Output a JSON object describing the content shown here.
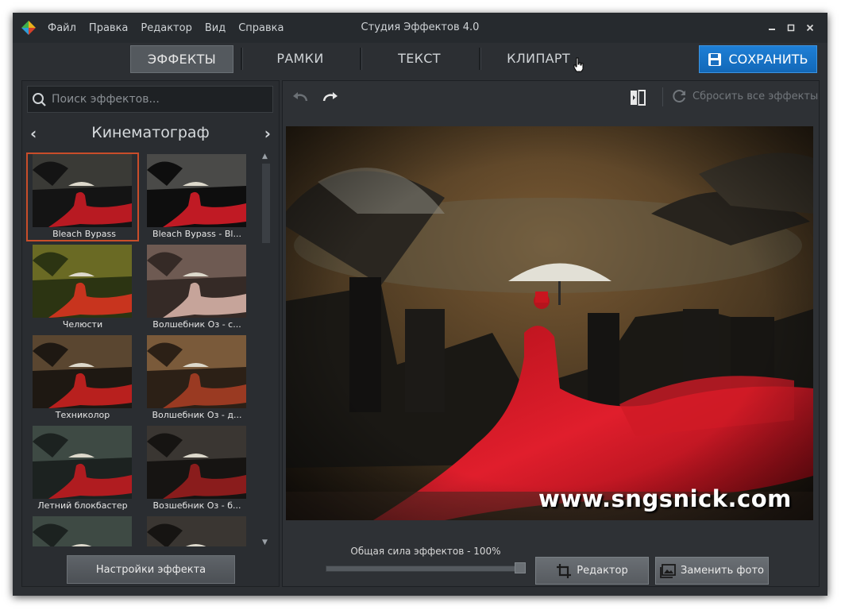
{
  "menu": [
    "Файл",
    "Правка",
    "Редактор",
    "Вид",
    "Справка"
  ],
  "window_title": "Студия Эффектов 4.0",
  "tabs": [
    {
      "label": "ЭФФЕКТЫ",
      "active": true
    },
    {
      "label": "РАМКИ",
      "active": false
    },
    {
      "label": "ТЕКСТ",
      "active": false
    },
    {
      "label": "КЛИПАРТ",
      "active": false
    }
  ],
  "save_label": "СОХРАНИТЬ",
  "search_placeholder": "Поиск эффектов...",
  "category": "Кинематограф",
  "effects": [
    {
      "label": "Bleach Bypass",
      "selected": true,
      "tone": "bleach"
    },
    {
      "label": "Bleach Bypass - Bl...",
      "selected": false,
      "tone": "bleach2"
    },
    {
      "label": "Челюсти",
      "selected": false,
      "tone": "green"
    },
    {
      "label": "Волшебник Оз - с...",
      "selected": false,
      "tone": "sepia"
    },
    {
      "label": "Техниколор",
      "selected": false,
      "tone": "techni"
    },
    {
      "label": "Волшебник Оз - д...",
      "selected": false,
      "tone": "brown"
    },
    {
      "label": "Летний блокбастер",
      "selected": false,
      "tone": "teal"
    },
    {
      "label": "Возшебник Оз - б...",
      "selected": false,
      "tone": "dark"
    },
    {
      "label": "",
      "selected": false,
      "tone": "teal"
    },
    {
      "label": "",
      "selected": false,
      "tone": "dark"
    }
  ],
  "settings_button": "Настройки эффекта",
  "reset_label": "Сбросить все эффекты",
  "strength_label": "Общая сила эффектов - 100%",
  "strength_value": 1.0,
  "editor_button": "Редактор",
  "replace_button": "Заменить фото",
  "watermark": "www.sngsnick.com",
  "colors": {
    "accent": "#1a74c9",
    "selected_border": "#c94d2a",
    "window_bg": "#2c2f33"
  }
}
